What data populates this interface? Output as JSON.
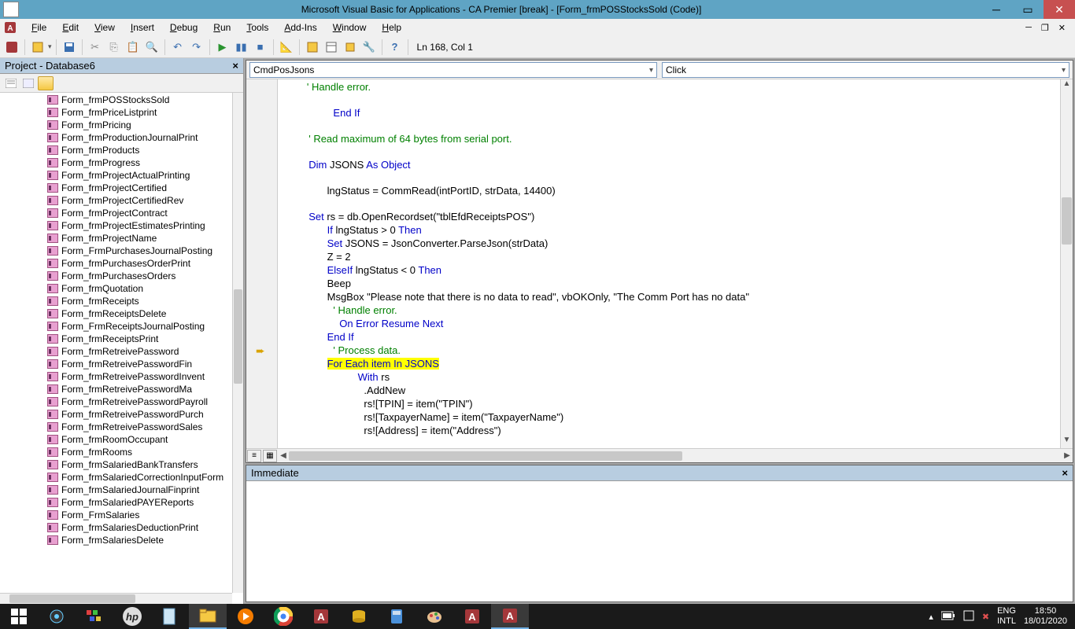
{
  "titlebar": {
    "text": "Microsoft Visual Basic for Applications - CA Premier [break] - [Form_frmPOSStocksSold (Code)]"
  },
  "menubar": {
    "file": "File",
    "edit": "Edit",
    "view": "View",
    "insert": "Insert",
    "debug": "Debug",
    "run": "Run",
    "tools": "Tools",
    "addins": "Add-Ins",
    "window": "Window",
    "help": "Help"
  },
  "toolbar": {
    "position": "Ln 168, Col 1"
  },
  "project": {
    "title": "Project - Database6",
    "items": [
      "Form_frmPOSStocksSold",
      "Form_frmPriceListprint",
      "Form_frmPricing",
      "Form_frmProductionJournalPrint",
      "Form_frmProducts",
      "Form_frmProgress",
      "Form_frmProjectActualPrinting",
      "Form_frmProjectCertified",
      "Form_frmProjectCertifiedRev",
      "Form_frmProjectContract",
      "Form_frmProjectEstimatesPrinting",
      "Form_frmProjectName",
      "Form_FrmPurchasesJournalPosting",
      "Form_frmPurchasesOrderPrint",
      "Form_frmPurchasesOrders",
      "Form_frmQuotation",
      "Form_frmReceipts",
      "Form_frmReceiptsDelete",
      "Form_FrmReceiptsJournalPosting",
      "Form_frmReceiptsPrint",
      "Form_frmRetreivePassword",
      "Form_frmRetreivePasswordFin",
      "Form_frmRetreivePasswordInvent",
      "Form_frmRetreivePasswordMa",
      "Form_frmRetreivePasswordPayroll",
      "Form_frmRetreivePasswordPurch",
      "Form_frmRetreivePasswordSales",
      "Form_frmRoomOccupant",
      "Form_frmRooms",
      "Form_frmSalariedBankTransfers",
      "Form_frmSalariedCorrectionInputForm",
      "Form_frmSalariedJournalFinprint",
      "Form_frmSalariedPAYEReports",
      "Form_FrmSalaries",
      "Form_frmSalariesDeductionPrint",
      "Form_frmSalariesDelete"
    ]
  },
  "code": {
    "object": "CmdPosJsons",
    "proc": "Click",
    "tokens": {
      "handle_error": "' Handle error.",
      "end_if": "End If",
      "read_comment": "' Read maximum of 64 bytes from serial port.",
      "dim": "Dim",
      "jsons": " JSONS ",
      "as_object": "As Object",
      "lng_assign": "lngStatus = CommRead(intPortID, strData, 14400)",
      "set": "Set",
      "rs_open": " rs = db.OpenRecordset(\"tblEfdReceiptsPOS\")",
      "if": "If",
      "lng_gt0": " lngStatus > 0 ",
      "then": "Then",
      "jsons_parse": " JSONS = JsonConverter.ParseJson(strData)",
      "z2": "Z = 2",
      "elseif": "ElseIf",
      "lng_lt0": " lngStatus < 0 ",
      "beep": "Beep",
      "msgbox": "MsgBox \"Please note that there is no data to read\", vbOKOnly, \"The Comm Port has no data\"",
      "on_error": "On Error Resume Next",
      "process": "' Process data.",
      "for_each": "For Each item In JSONS",
      "with_rs": "With",
      "rs_txt": " rs",
      "addnew": ".AddNew",
      "tpin": "rs![TPIN] = item(\"TPIN\")",
      "taxpayer": "rs![TaxpayerName] = item(\"TaxpayerName\")",
      "address": "rs![Address] = item(\"Address\")"
    }
  },
  "immediate": {
    "title": "Immediate"
  },
  "taskbar": {
    "lang1": "ENG",
    "lang2": "INTL",
    "time": "18:50",
    "date": "18/01/2020"
  }
}
